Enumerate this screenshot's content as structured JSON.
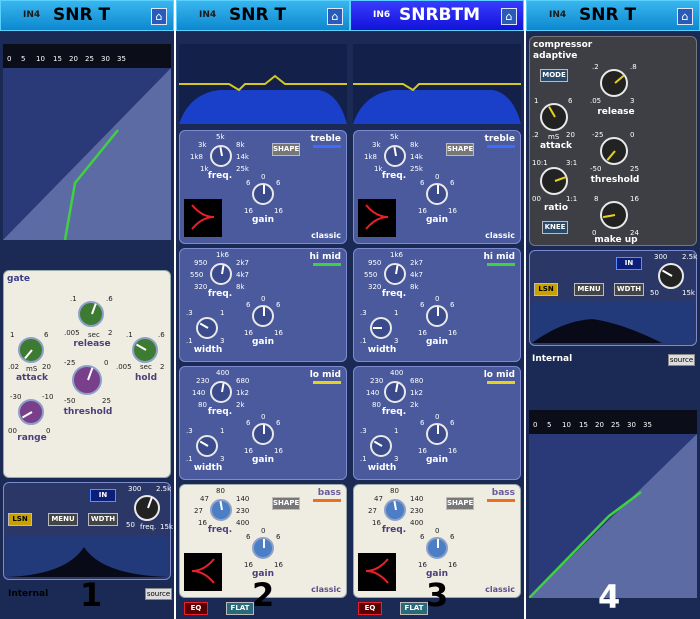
{
  "strips": [
    {
      "num": "1",
      "in": "IN4",
      "title": "SNR T",
      "meter_ticks": [
        "0",
        "5",
        "10",
        "15",
        "20",
        "25",
        "30",
        "35"
      ],
      "gate": {
        "title": "gate",
        "release_label": "release",
        "release_ticks": [
          ".1",
          ".6",
          ".005",
          "sec",
          "2"
        ],
        "attack_label": "attack",
        "attack_ticks": [
          "1",
          "6",
          ".02",
          "mS",
          "20"
        ],
        "hold_label": "hold",
        "hold_ticks": [
          ".1",
          ".6",
          ".005",
          "sec",
          "2"
        ],
        "threshold_label": "threshold",
        "threshold_ticks": [
          "-25",
          "0",
          "-50",
          "25"
        ],
        "range_label": "range",
        "range_ticks": [
          "-30",
          "-10",
          "00",
          "0"
        ]
      },
      "ctrl": {
        "in": "IN",
        "lsn": "LSN",
        "menu": "MENU",
        "wdth": "WDTH",
        "freq_label": "freq.",
        "freq_ticks": [
          "300",
          "2.5k",
          "50",
          "15k"
        ]
      },
      "source_name": "Internal",
      "source_button": "source"
    },
    {
      "num": "2",
      "in": "IN4",
      "title": "SNR T"
    },
    {
      "num": "3",
      "in": "IN6",
      "title": "SNRBTM"
    },
    {
      "num": "4",
      "in": "IN4",
      "title": "SNR T",
      "comp": {
        "title": "compressor",
        "subtitle": "adaptive",
        "mode": "MODE",
        "release_label": "release",
        "release_ticks": [
          ".2",
          ".8",
          ".05",
          "3"
        ],
        "attack_label": "attack",
        "attack_ticks": [
          "1",
          "6",
          ".2",
          "mS",
          "20"
        ],
        "threshold_label": "threshold",
        "threshold_ticks": [
          "-25",
          "0",
          "-50",
          "25"
        ],
        "ratio_label": "ratio",
        "ratio_ticks": [
          "10:1",
          "3:1",
          "00",
          "1:1"
        ],
        "knee": "KNEE",
        "makeup_label": "make up",
        "makeup_ticks": [
          "8",
          "16",
          "0",
          "24"
        ]
      },
      "ctrl": {
        "in": "IN",
        "lsn": "LSN",
        "menu": "MENU",
        "wdth": "WDTH",
        "freq_ticks": [
          "300",
          "2.5k",
          "50",
          "15k"
        ]
      },
      "source_name": "Internal",
      "source_button": "source",
      "meter_ticks": [
        "0",
        "5",
        "10",
        "15",
        "20",
        "25",
        "30",
        "35"
      ]
    }
  ],
  "eq": {
    "treble": {
      "title": "treble",
      "shape": "SHAPE",
      "freq_label": "freq.",
      "freq_ticks": [
        "5k",
        "3k",
        "8k",
        "1k8",
        "14k",
        "1k",
        "25k"
      ],
      "gain_label": "gain",
      "gain_ticks": [
        "0",
        "6",
        "6",
        "16",
        "16"
      ],
      "mode": "classic"
    },
    "himid": {
      "title": "hi mid",
      "freq_label": "freq.",
      "freq_ticks": [
        "1k6",
        "950",
        "2k7",
        "550",
        "4k7",
        "320",
        "8k"
      ],
      "width_label": "width",
      "width_ticks": [
        ".3",
        "1",
        ".1",
        "3"
      ],
      "gain_label": "gain",
      "gain_ticks": [
        "0",
        "6",
        "6",
        "16",
        "16"
      ]
    },
    "lomid": {
      "title": "lo mid",
      "freq_label": "freq.",
      "freq_ticks": [
        "400",
        "230",
        "680",
        "140",
        "1k2",
        "80",
        "2k"
      ],
      "width_label": "width",
      "width_ticks": [
        ".3",
        "1",
        ".1",
        "3"
      ],
      "gain_label": "gain",
      "gain_ticks": [
        "0",
        "6",
        "6",
        "16",
        "16"
      ]
    },
    "bass": {
      "title": "bass",
      "shape": "SHAPE",
      "freq_label": "freq.",
      "freq_ticks": [
        "80",
        "47",
        "140",
        "27",
        "230",
        "16",
        "400"
      ],
      "gain_label": "gain",
      "gain_ticks": [
        "0",
        "6",
        "6",
        "16",
        "16"
      ],
      "mode": "classic"
    },
    "eq_button": "EQ",
    "flat_button": "FLAT"
  },
  "colors": {
    "green": "#3fd13f",
    "yellow": "#e6d21e",
    "red": "#e8202a",
    "blue": "#3a6dff",
    "orange": "#e87020"
  }
}
